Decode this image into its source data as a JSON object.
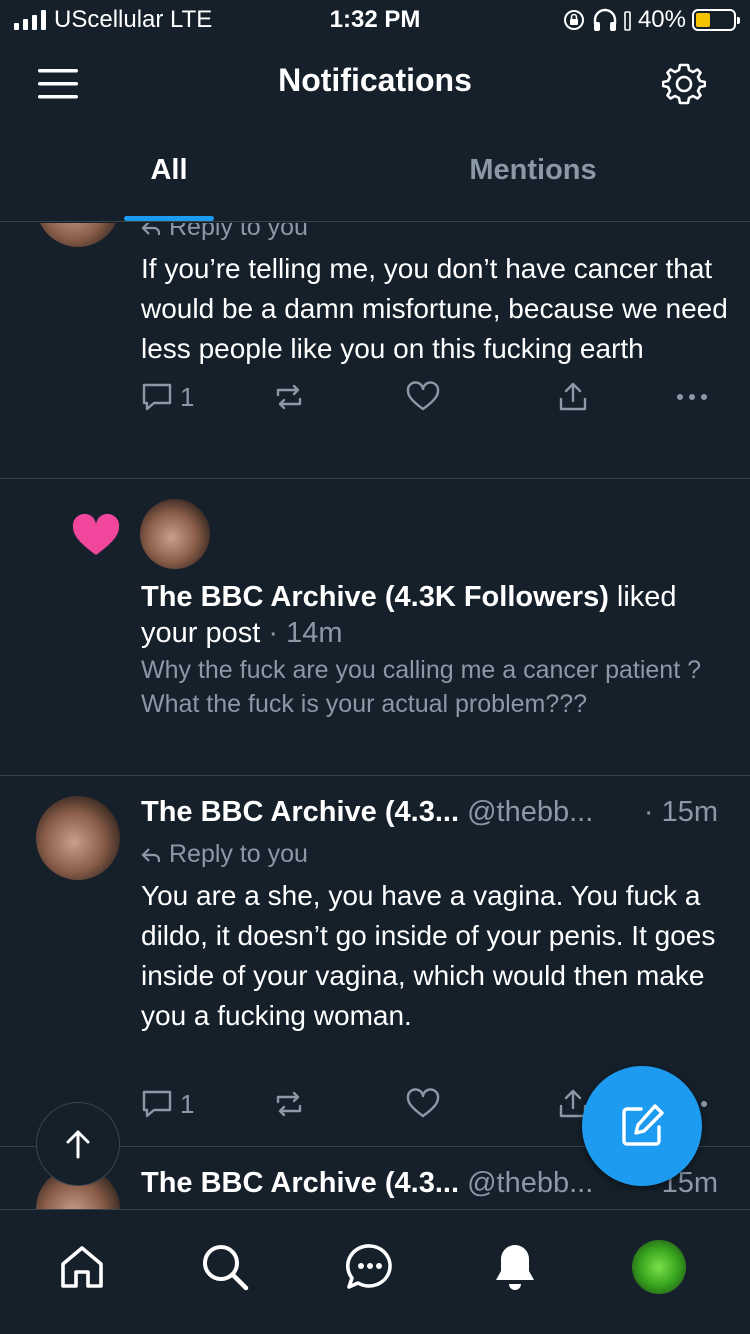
{
  "status_bar": {
    "carrier": "UScellular  LTE",
    "time": "1:32 PM",
    "battery": "40%",
    "battery_level": 0.4
  },
  "header": {
    "title": "Notifications"
  },
  "tabs": [
    {
      "label": "All",
      "active": true
    },
    {
      "label": "Mentions",
      "active": false
    }
  ],
  "feed": {
    "reply_top": {
      "replying_label": "Reply to you",
      "text": "If you’re telling me, you don’t have cancer that would be a damn misfortune, because we need less people like you on this fucking earth",
      "reply_count": "1"
    },
    "like_notification": {
      "name": "The BBC Archive (4.3K Followers)",
      "action": "liked your post",
      "time": "· 14m",
      "preview": "Why the fuck are you calling me a cancer patient ? What the fuck is your actual problem???"
    },
    "reply_middle": {
      "name": "The BBC Archive (4.3...",
      "handle": "@thebb...",
      "time": "· 15m",
      "replying_label": "Reply to you",
      "text": "You are a she, you have a vagina. You fuck a dildo, it doesn’t go inside of your penis. It goes inside of your vagina, which would then make you a fucking woman.",
      "reply_count": "1"
    },
    "reply_bottom": {
      "name": "The BBC Archive (4.3...",
      "handle": "@thebb...",
      "time": "15m"
    }
  },
  "colors": {
    "background": "#15202b",
    "accent": "#1d9bf0",
    "like": "#f91880",
    "divider": "#38444d",
    "muted_text": "#8b98a5"
  },
  "bottom_nav": [
    "home-icon",
    "search-icon",
    "messages-icon",
    "notifications-bell-icon",
    "profile-avatar"
  ]
}
